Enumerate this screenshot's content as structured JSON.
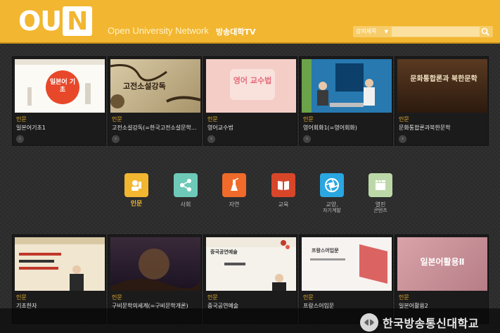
{
  "header": {
    "logo_text": "OU",
    "logo_n": "N",
    "network": "Open University Network",
    "tv": "방송대학TV",
    "search": {
      "select_label": "강의제목",
      "placeholder": ""
    }
  },
  "row1": [
    {
      "category": "인문",
      "title": "일본어기초1",
      "thumb_text": "일본어 기초"
    },
    {
      "category": "인문",
      "title": "고전소설강독(=한국고전소설문학...",
      "thumb_text": "고전소설강독"
    },
    {
      "category": "인문",
      "title": "영어교수법",
      "thumb_text": "영어 교수법"
    },
    {
      "category": "인문",
      "title": "영어회화1(=영어회화)",
      "thumb_text": ""
    },
    {
      "category": "인문",
      "title": "문화통합론과북한문학",
      "thumb_text": "문화통합론과 북한문학"
    }
  ],
  "categories": [
    {
      "label": "인문",
      "sub": "",
      "color": "#f2b630",
      "icon": "person-icon"
    },
    {
      "label": "사회",
      "sub": "",
      "color": "#6ec9b8",
      "icon": "share-icon"
    },
    {
      "label": "자연",
      "sub": "",
      "color": "#f06a2a",
      "icon": "flask-icon"
    },
    {
      "label": "교육",
      "sub": "",
      "color": "#d8462a",
      "icon": "book-icon"
    },
    {
      "label": "교양,",
      "sub": "자기계발",
      "color": "#2aa6e0",
      "icon": "aperture-icon"
    },
    {
      "label": "열린",
      "sub": "콘텐츠",
      "color": "#bcd8a8",
      "icon": "clapper-icon"
    }
  ],
  "row2": [
    {
      "category": "인문",
      "title": "기초한자",
      "thumb_text": ""
    },
    {
      "category": "인문",
      "title": "구비문학의세계(=구비문학개론)",
      "thumb_text": ""
    },
    {
      "category": "인문",
      "title": "중국공연예술",
      "thumb_text": "중국공연예술"
    },
    {
      "category": "인문",
      "title": "프랑스어입문",
      "thumb_text": "프랑스어입문"
    },
    {
      "category": "인문",
      "title": "일본어활용2",
      "thumb_text": "일본어활용Ⅱ"
    }
  ],
  "footer": {
    "text": "한국방송통신대학교"
  }
}
